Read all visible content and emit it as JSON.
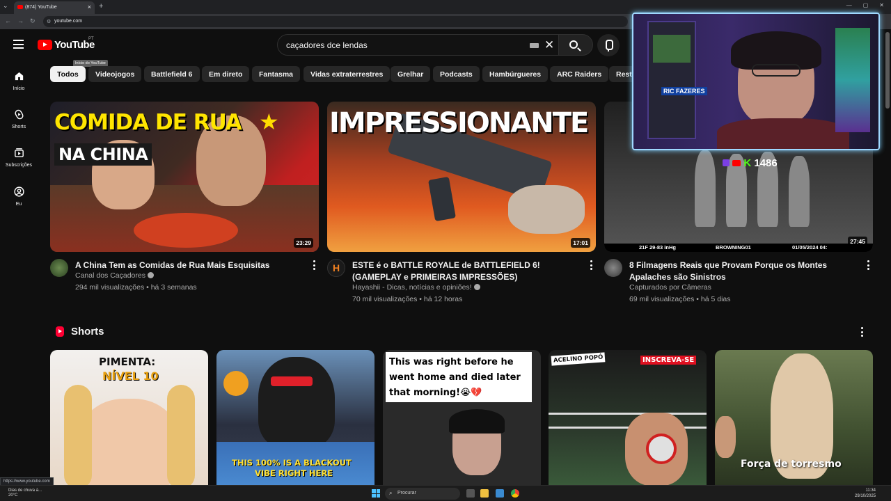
{
  "browser": {
    "tab_title": "(874) YouTube",
    "url": "youtube.com",
    "status_url": "https://www.youtube.com"
  },
  "header": {
    "logo_text": "YouTube",
    "region": "PT",
    "logo_tooltip": "Início do YouTube",
    "search_value": "caçadores dce lendas"
  },
  "sidebar": {
    "items": [
      {
        "label": "Início",
        "icon": "home-icon"
      },
      {
        "label": "Shorts",
        "icon": "shorts-icon"
      },
      {
        "label": "Subscrições",
        "icon": "subscriptions-icon"
      },
      {
        "label": "Eu",
        "icon": "account-icon"
      }
    ]
  },
  "chips": [
    "Todos",
    "Videojogos",
    "Battlefield 6",
    "Em direto",
    "Fantasma",
    "Vidas extraterrestres",
    "Grelhar",
    "Podcasts",
    "Hambúrgueres",
    "ARC Raiders",
    "Resta"
  ],
  "videos": [
    {
      "title": "A China Tem as Comidas de Rua Mais Esquisitas",
      "channel": "Canal dos Caçadores",
      "meta": "294 mil visualizações • há 3 semanas",
      "duration": "23:29",
      "thumb_line1": "COMIDA DE RUA",
      "thumb_line2": "NA CHINA"
    },
    {
      "title": "ESTE é o BATTLE ROYALE de BATTLEFIELD 6! (GAMEPLAY e PRIMEIRAS IMPRESSÕES)",
      "channel": "Hayashii - Dicas, notícias e opiniões!",
      "meta": "70 mil visualizações • há 12 horas",
      "duration": "17:01",
      "thumb_line1": "IMPRESSIONANTE"
    },
    {
      "title": "8 Filmagens Reais que Provam Porque os Montes Apalaches são Sinistros",
      "channel": "Capturados por Câmeras",
      "meta": "69 mil visualizações • há 5 dias",
      "duration": "27:45",
      "thumb_cam_left": "21F  29-83 inHg",
      "thumb_cam_mid": "BROWNING01",
      "thumb_cam_right": "01/05/2024 04:"
    }
  ],
  "shorts": {
    "title": "Shorts",
    "items": [
      {
        "caption": "PIMENTA:",
        "caption2": "NÍVEL 10"
      },
      {
        "caption": "THIS 100% IS A BLACKOUT",
        "caption2": "VIBE RIGHT HERE"
      },
      {
        "caption": "This was right before he",
        "caption2": "went home and died later",
        "caption3": "that morning!😭💔"
      },
      {
        "caption": "ACELINO POPÓ",
        "caption2": "INSCREVA-SE"
      },
      {
        "caption": "Força de torresmo"
      }
    ]
  },
  "webcam": {
    "counter": "1486",
    "sign": "RIC FAZERES"
  },
  "taskbar": {
    "weather_line1": "Dias de chuva à...",
    "weather_line2": "20°C",
    "search_label": "Procurar",
    "time": "11:34",
    "date": "29/10/2025"
  },
  "colors": {
    "background": "#0f0f0f",
    "brand_red": "#ff0000",
    "chip_bg": "#272727"
  }
}
